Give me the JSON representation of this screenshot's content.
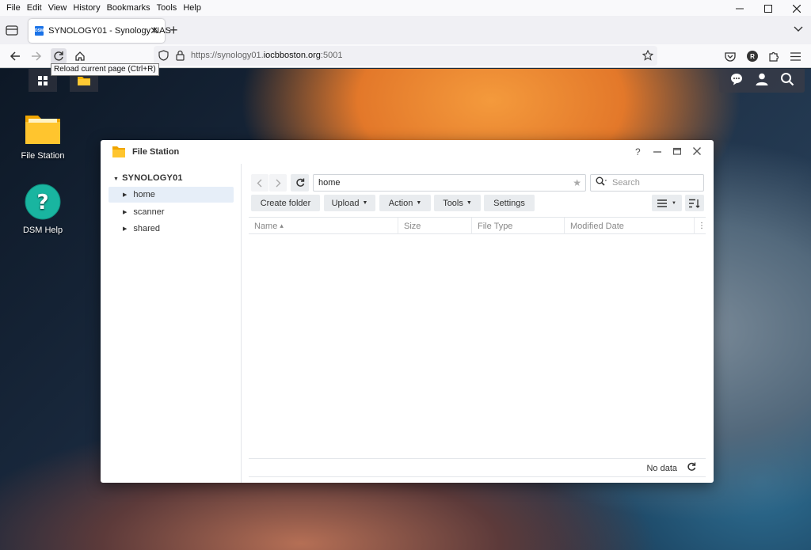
{
  "browser": {
    "menu": [
      "File",
      "Edit",
      "View",
      "History",
      "Bookmarks",
      "Tools",
      "Help"
    ],
    "tab": {
      "favicon_text": "DSM",
      "title": "SYNOLOGY01 - Synology NAS"
    },
    "url": {
      "prefix": "https://synology01.",
      "domain": "iocbboston.org",
      "suffix": ":5001"
    },
    "tooltip": "Reload current page (Ctrl+R)",
    "profile_letter": "R",
    "icons": {
      "tab_list": "tab-list-icon",
      "new_tab": "plus-icon",
      "back": "arrow-left-icon",
      "forward": "arrow-right-icon",
      "reload": "reload-icon",
      "home": "home-icon",
      "shield": "shield-icon",
      "lock": "lock-icon",
      "bookmark": "star-icon",
      "pocket": "pocket-icon",
      "extensions": "puzzle-icon",
      "menu": "hamburger-icon"
    }
  },
  "desktop": {
    "icons": [
      {
        "label": "File Station"
      },
      {
        "label": "DSM Help"
      }
    ]
  },
  "window": {
    "title": "File Station",
    "tree": {
      "root": "SYNOLOGY01",
      "items": [
        "home",
        "scanner",
        "shared"
      ],
      "selected": "home"
    },
    "path": "home",
    "search_placeholder": "Search",
    "toolbar": {
      "create_folder": "Create folder",
      "upload": "Upload",
      "action": "Action",
      "tools": "Tools",
      "settings": "Settings"
    },
    "columns": [
      "Name",
      "Size",
      "File Type",
      "Modified Date"
    ],
    "sort_indicator": "▴",
    "status": "No data"
  }
}
